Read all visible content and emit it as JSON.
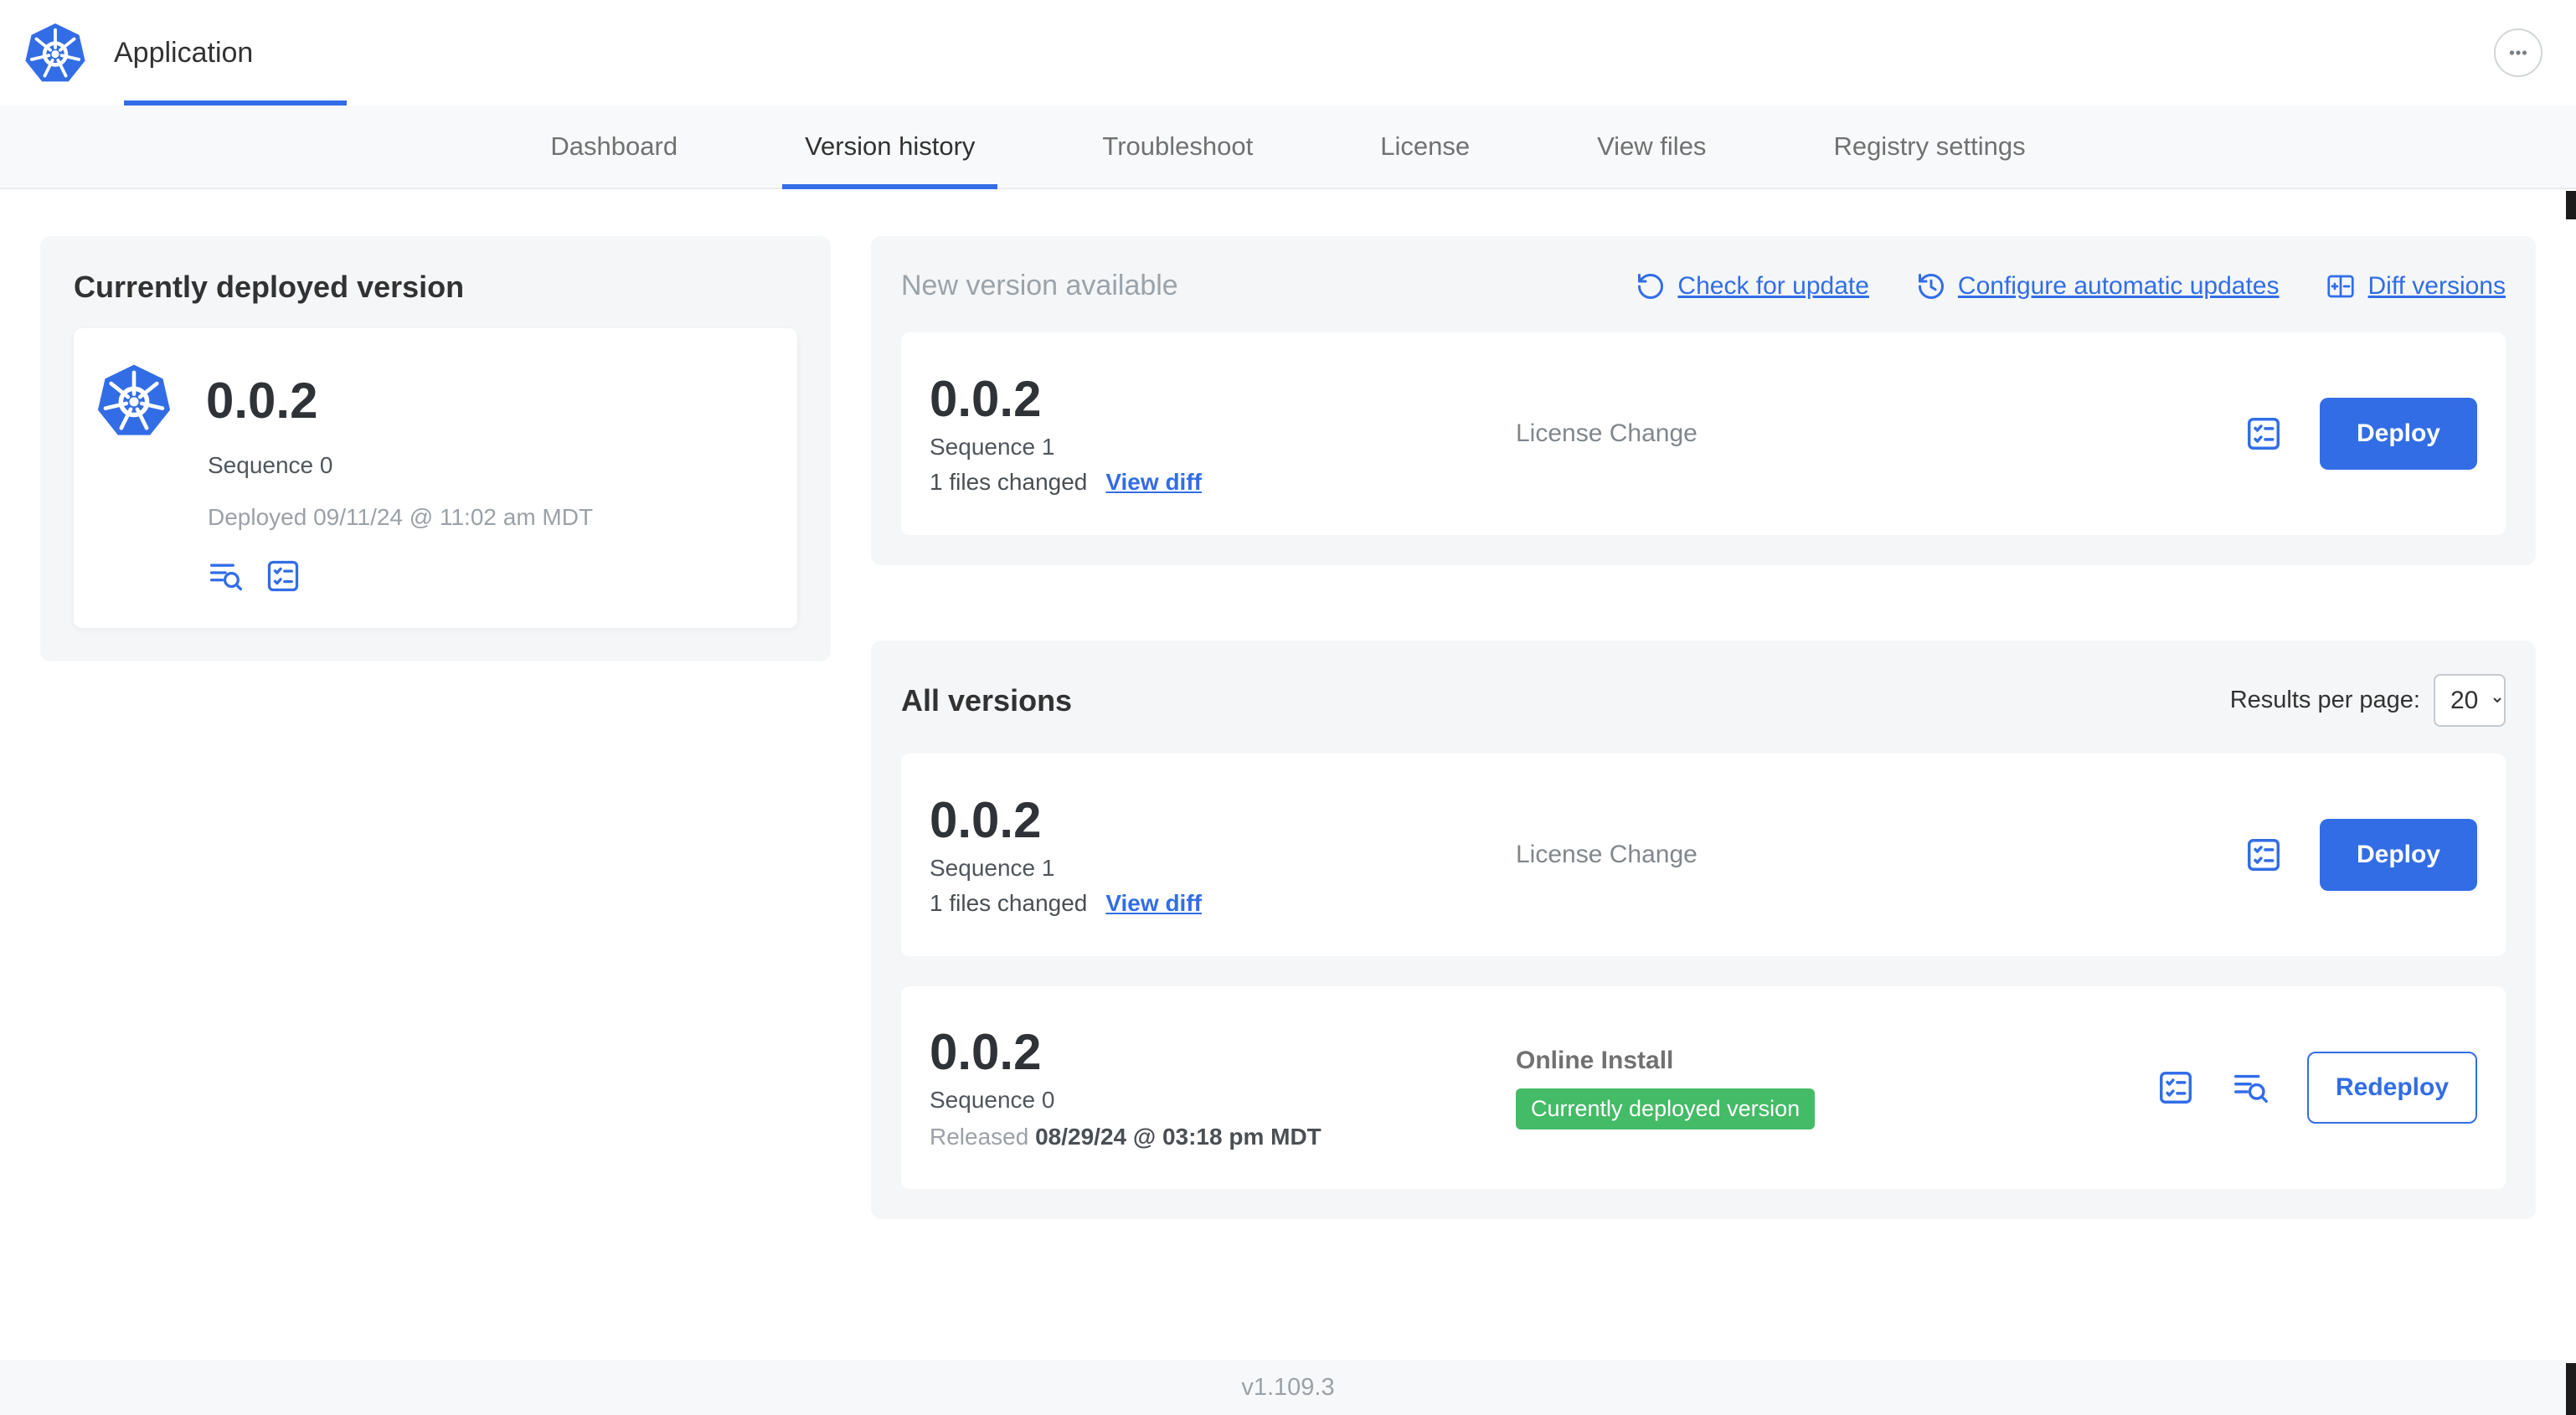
{
  "header": {
    "app_title": "Application"
  },
  "tabs": {
    "dashboard": "Dashboard",
    "version_history": "Version history",
    "troubleshoot": "Troubleshoot",
    "license": "License",
    "view_files": "View files",
    "registry_settings": "Registry settings"
  },
  "currently_deployed": {
    "title": "Currently deployed version",
    "version": "0.0.2",
    "sequence": "Sequence 0",
    "deployed_at": "Deployed 09/11/24 @ 11:02 am MDT"
  },
  "new_version": {
    "title": "New version available",
    "check_for_update": "Check for update",
    "configure_automatic_updates": "Configure automatic updates",
    "diff_versions": "Diff versions",
    "row": {
      "version": "0.0.2",
      "sequence": "Sequence 1",
      "files_changed": "1 files changed",
      "view_diff": "View diff",
      "source": "License Change",
      "action": "Deploy"
    }
  },
  "all_versions": {
    "title": "All versions",
    "results_per_page_label": "Results per page:",
    "results_per_page": "20",
    "rows": [
      {
        "version": "0.0.2",
        "sequence": "Sequence 1",
        "files_changed": "1 files changed",
        "view_diff": "View diff",
        "source": "License Change",
        "action": "Deploy"
      },
      {
        "version": "0.0.2",
        "sequence": "Sequence 0",
        "released_label": "Released",
        "released_date": "08/29/24 @ 03:18 pm MDT",
        "source": "Online Install",
        "badge": "Currently deployed version",
        "action": "Redeploy"
      }
    ]
  },
  "footer": {
    "version": "v1.109.3"
  },
  "colors": {
    "primary_blue": "#326de6",
    "badge_green": "#44bb66",
    "card_gray": "#f4f6f8"
  }
}
